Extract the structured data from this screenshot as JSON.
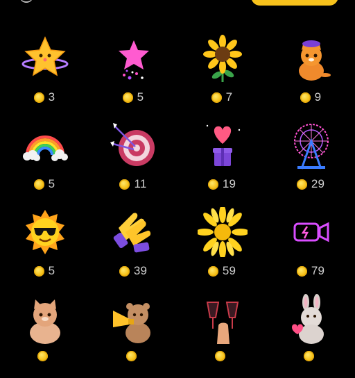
{
  "colors": {
    "background": "#000000",
    "accent": "#f7c21c",
    "text": "#d0d0d0",
    "coin": "#f6c21a"
  },
  "header": {
    "top_button_icon": "yellow-pill-button"
  },
  "gifts": [
    {
      "icon": "star-planet-icon",
      "price": "3"
    },
    {
      "icon": "pink-sparkle-star-icon",
      "price": "5"
    },
    {
      "icon": "sunflower-icon",
      "price": "7"
    },
    {
      "icon": "orange-cat-icon",
      "price": "9"
    },
    {
      "icon": "rainbow-icon",
      "price": "5"
    },
    {
      "icon": "dartboard-icon",
      "price": "11"
    },
    {
      "icon": "heart-gift-box-icon",
      "price": "19"
    },
    {
      "icon": "ferris-wheel-icon",
      "price": "29"
    },
    {
      "icon": "cool-sun-icon",
      "price": "5"
    },
    {
      "icon": "clapping-hands-icon",
      "price": "39"
    },
    {
      "icon": "yellow-flower-icon",
      "price": "59"
    },
    {
      "icon": "neon-camera-icon",
      "price": "79"
    },
    {
      "icon": "chubby-cat-icon",
      "price": ""
    },
    {
      "icon": "bear-trumpet-icon",
      "price": ""
    },
    {
      "icon": "cheers-glasses-icon",
      "price": ""
    },
    {
      "icon": "bunny-icon",
      "price": ""
    }
  ]
}
